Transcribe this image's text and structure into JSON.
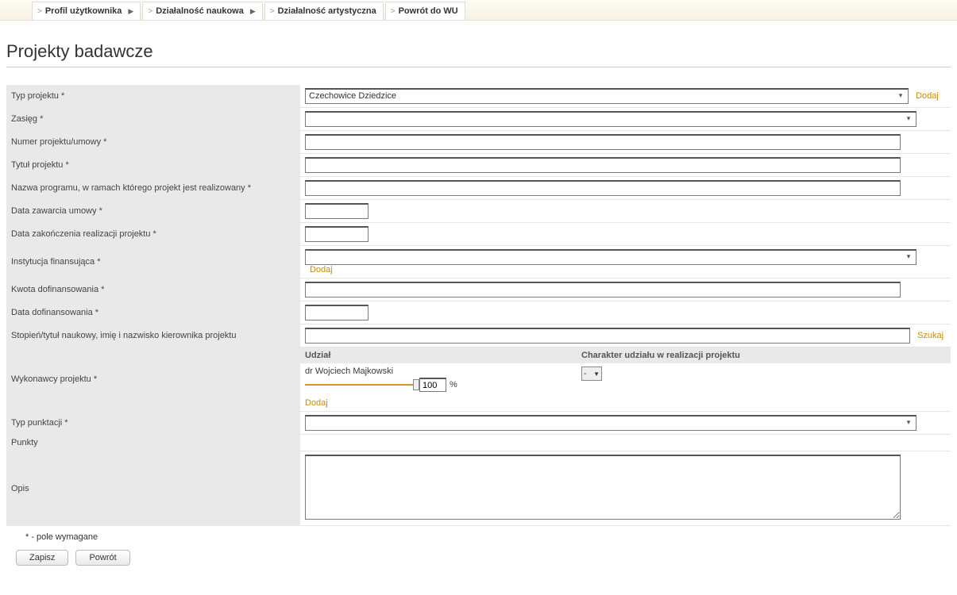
{
  "nav": {
    "items": [
      {
        "label": "Profil użytkownika",
        "hasArrow": true
      },
      {
        "label": "Działalność naukowa",
        "hasArrow": true
      },
      {
        "label": "Działalność artystyczna",
        "hasArrow": false
      },
      {
        "label": "Powrót do WU",
        "hasArrow": false
      }
    ]
  },
  "page": {
    "title": "Projekty badawcze",
    "requiredNote": "* - pole wymagane"
  },
  "fields": {
    "typ_projektu": {
      "label": "Typ projektu *",
      "value": "Czechowice Dziedzice",
      "action": "Dodaj"
    },
    "zasieg": {
      "label": "Zasięg *",
      "value": ""
    },
    "numer": {
      "label": "Numer projektu/umowy *",
      "value": ""
    },
    "tytul": {
      "label": "Tytuł projektu *",
      "value": ""
    },
    "program": {
      "label": "Nazwa programu, w ramach którego projekt jest realizowany *",
      "value": ""
    },
    "data_zaw": {
      "label": "Data zawarcia umowy *",
      "value": ""
    },
    "data_zak": {
      "label": "Data zakończenia realizacji projektu *",
      "value": ""
    },
    "instytucja": {
      "label": "Instytucja finansująca *",
      "value": "",
      "action": "Dodaj"
    },
    "kwota": {
      "label": "Kwota dofinansowania *",
      "value": ""
    },
    "data_dof": {
      "label": "Data dofinansowania *",
      "value": ""
    },
    "kierownik": {
      "label": "Stopień/tytuł naukowy, imię i nazwisko kierownika projektu",
      "value": "",
      "action": "Szukaj"
    },
    "wykonawcy": {
      "label": "Wykonawcy projektu *",
      "cols": {
        "udzial": "Udział",
        "charakter": "Charakter udziału w realizacji projektu"
      },
      "entry": {
        "name": "dr  Wojciech  Majkowski",
        "pct": "100",
        "pctSuffix": "%",
        "charakter": "-"
      },
      "action": "Dodaj"
    },
    "typ_punktacji": {
      "label": "Typ punktacji *",
      "value": ""
    },
    "punkty": {
      "label": "Punkty",
      "value": ""
    },
    "opis": {
      "label": "Opis",
      "value": ""
    }
  },
  "buttons": {
    "save": "Zapisz",
    "back": "Powrót"
  }
}
